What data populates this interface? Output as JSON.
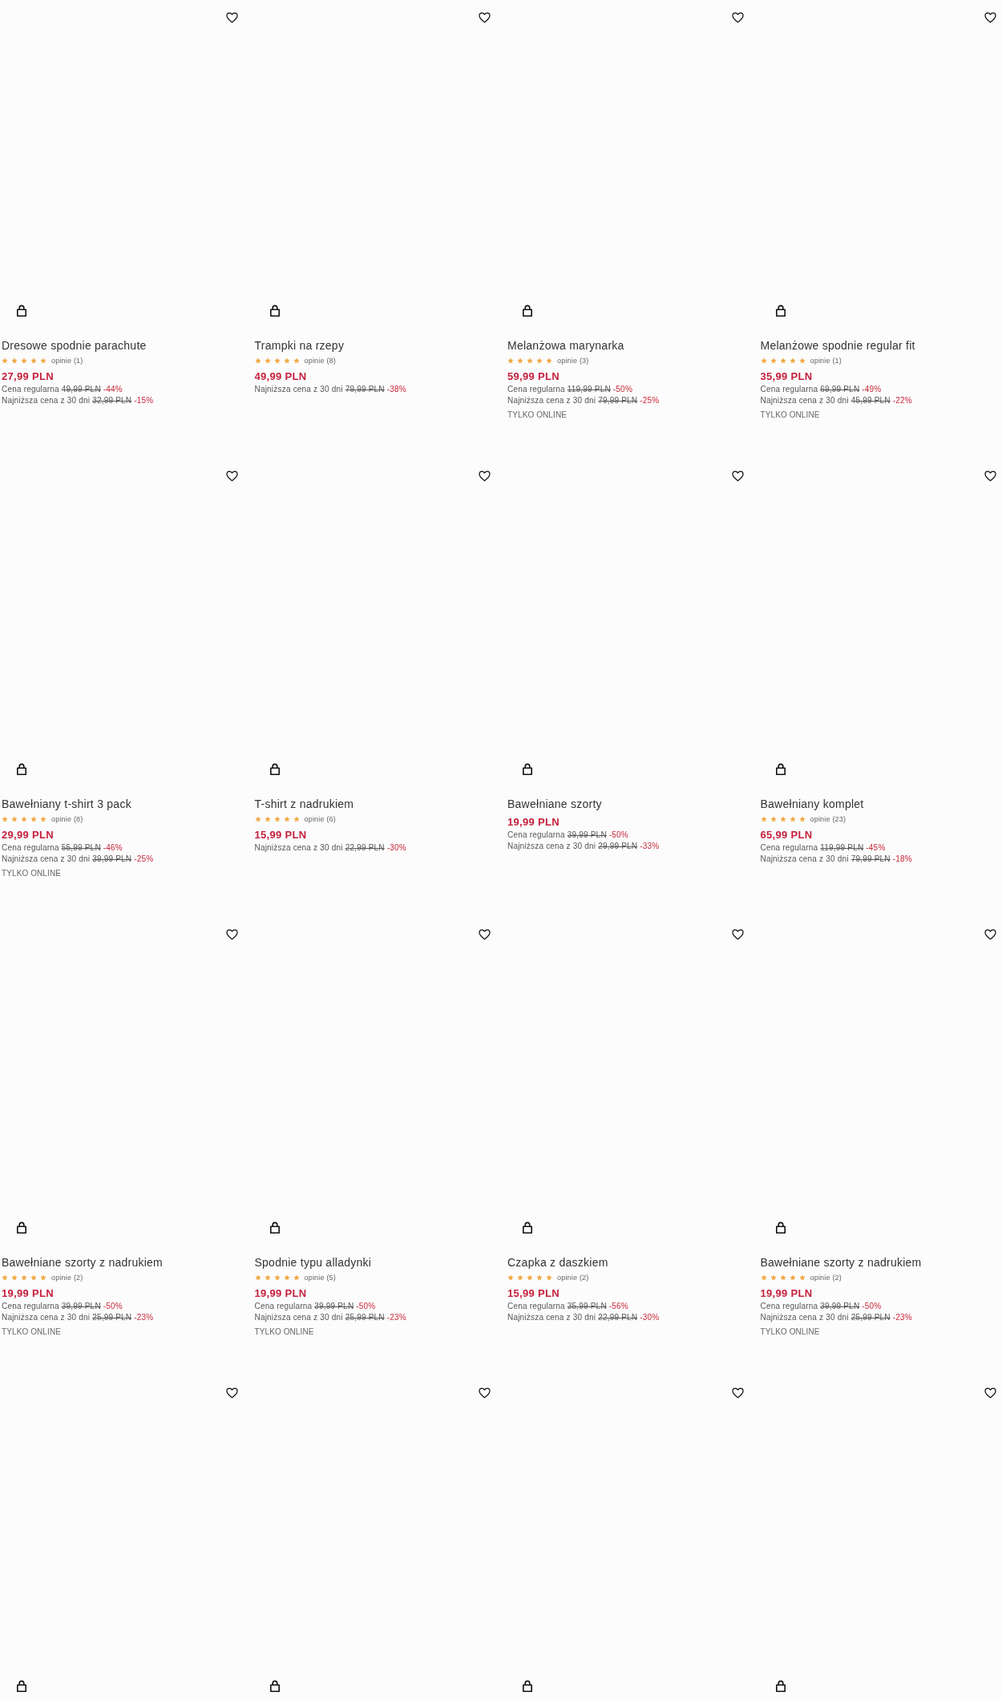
{
  "products": [
    {
      "title": "Dresowe spodnie parachute",
      "stars": 5,
      "reviews": "opinie (1)",
      "price": "27,99 PLN",
      "price_notes": [
        {
          "label": "Cena regularna",
          "old_price": "49,99 PLN",
          "discount": "-44%"
        },
        {
          "label": "Najniższa cena z 30 dni",
          "old_price": "32,99 PLN",
          "discount": "-15%"
        }
      ],
      "favorite": false
    },
    {
      "title": "Trampki na rzepy",
      "stars": 5,
      "reviews": "opinie (8)",
      "price": "49,99 PLN",
      "price_notes": [
        {
          "label": "Najniższa cena z 30 dni",
          "old_price": "79,99 PLN",
          "discount": "-38%"
        }
      ],
      "favorite": false
    },
    {
      "title": "Melanżowa marynarka",
      "stars": 5,
      "reviews": "opinie (3)",
      "price": "59,99 PLN",
      "price_notes": [
        {
          "label": "Cena regularna",
          "old_price": "119,99 PLN",
          "discount": "-50%"
        },
        {
          "label": "Najniższa cena z 30 dni",
          "old_price": "79,99 PLN",
          "discount": "-25%"
        }
      ],
      "badge": "TYLKO ONLINE",
      "favorite": false
    },
    {
      "title": "Melanżowe spodnie regular fit",
      "stars": 5,
      "reviews": "opinie (1)",
      "price": "35,99 PLN",
      "price_notes": [
        {
          "label": "Cena regularna",
          "old_price": "69,99 PLN",
          "discount": "-49%"
        },
        {
          "label": "Najniższa cena z 30 dni",
          "old_price": "45,99 PLN",
          "discount": "-22%"
        }
      ],
      "badge": "TYLKO ONLINE",
      "favorite": false
    },
    {
      "title": "Bawełniany t-shirt 3 pack",
      "stars": 5,
      "reviews": "opinie (8)",
      "price": "29,99 PLN",
      "price_notes": [
        {
          "label": "Cena regularna",
          "old_price": "55,99 PLN",
          "discount": "-46%"
        },
        {
          "label": "Najniższa cena z 30 dni",
          "old_price": "39,99 PLN",
          "discount": "-25%"
        }
      ],
      "badge": "TYLKO ONLINE",
      "favorite": false
    },
    {
      "title": "T-shirt z nadrukiem",
      "stars": 5,
      "reviews": "opinie (6)",
      "price": "15,99 PLN",
      "price_notes": [
        {
          "label": "Najniższa cena z 30 dni",
          "old_price": "22,99 PLN",
          "discount": "-30%"
        }
      ],
      "favorite": false
    },
    {
      "title": "Bawełniane szorty",
      "price": "19,99 PLN",
      "price_notes": [
        {
          "label": "Cena regularna",
          "old_price": "39,99 PLN",
          "discount": "-50%"
        },
        {
          "label": "Najniższa cena z 30 dni",
          "old_price": "29,99 PLN",
          "discount": "-33%"
        }
      ],
      "favorite": false
    },
    {
      "title": "Bawełniany komplet",
      "stars": 5,
      "reviews": "opinie (23)",
      "price": "65,99 PLN",
      "price_notes": [
        {
          "label": "Cena regularna",
          "old_price": "119,99 PLN",
          "discount": "-45%"
        },
        {
          "label": "Najniższa cena z 30 dni",
          "old_price": "79,99 PLN",
          "discount": "-18%"
        }
      ],
      "favorite": false
    },
    {
      "title": "Bawełniane szorty z nadrukiem",
      "stars": 5,
      "reviews": "opinie (2)",
      "price": "19,99 PLN",
      "price_notes": [
        {
          "label": "Cena regularna",
          "old_price": "39,99 PLN",
          "discount": "-50%"
        },
        {
          "label": "Najniższa cena z 30 dni",
          "old_price": "25,99 PLN",
          "discount": "-23%"
        }
      ],
      "badge": "TYLKO ONLINE",
      "favorite": false
    },
    {
      "title": "Spodnie typu alladynki",
      "stars": 5,
      "reviews": "opinie (5)",
      "price": "19,99 PLN",
      "price_notes": [
        {
          "label": "Cena regularna",
          "old_price": "39,99 PLN",
          "discount": "-50%"
        },
        {
          "label": "Najniższa cena z 30 dni",
          "old_price": "25,99 PLN",
          "discount": "-23%"
        }
      ],
      "badge": "TYLKO ONLINE",
      "favorite": false
    },
    {
      "title": "Czapka z daszkiem",
      "stars": 5,
      "reviews": "opinie (2)",
      "price": "15,99 PLN",
      "price_notes": [
        {
          "label": "Cena regularna",
          "old_price": "35,99 PLN",
          "discount": "-56%"
        },
        {
          "label": "Najniższa cena z 30 dni",
          "old_price": "22,99 PLN",
          "discount": "-30%"
        }
      ],
      "favorite": false
    },
    {
      "title": "Bawełniane szorty z nadrukiem",
      "stars": 5,
      "reviews": "opinie (2)",
      "price": "19,99 PLN",
      "price_notes": [
        {
          "label": "Cena regularna",
          "old_price": "39,99 PLN",
          "discount": "-50%"
        },
        {
          "label": "Najniższa cena z 30 dni",
          "old_price": "25,99 PLN",
          "discount": "-23%"
        }
      ],
      "badge": "TYLKO ONLINE",
      "favorite": false
    },
    {
      "favorite": false
    },
    {
      "favorite": false
    },
    {
      "favorite": false
    },
    {
      "favorite": false
    }
  ]
}
